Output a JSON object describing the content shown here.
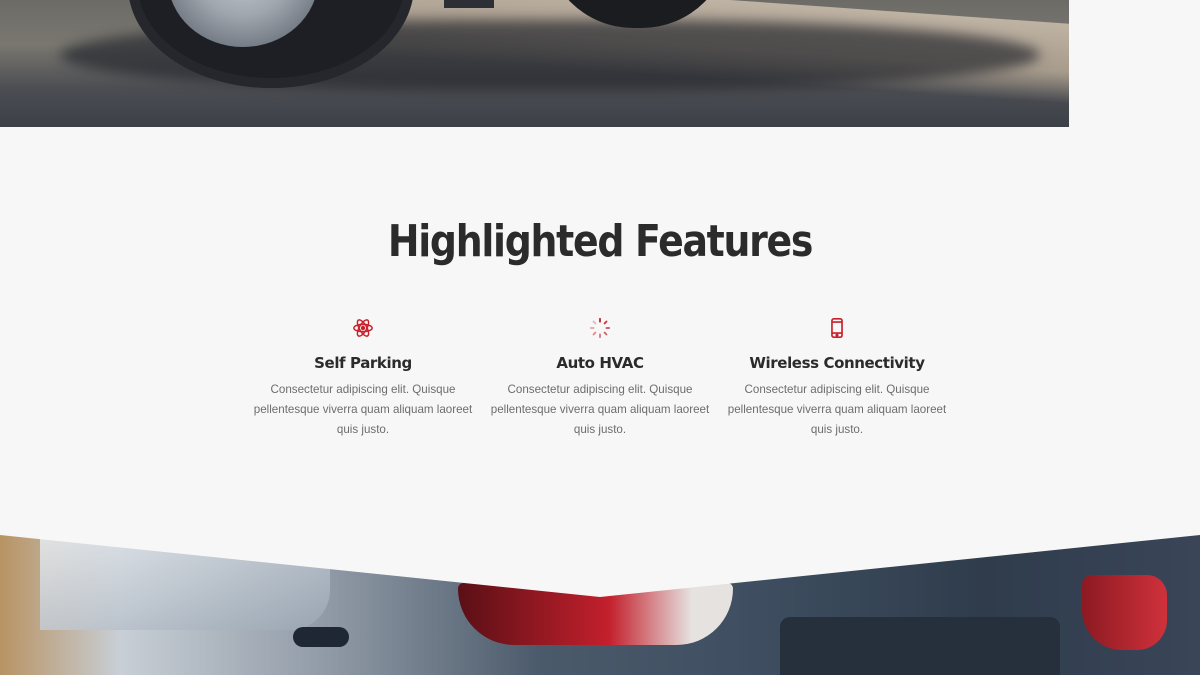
{
  "section": {
    "title": "Highlighted Features"
  },
  "accent_color": "#c8202b",
  "features": [
    {
      "icon": "atom-icon",
      "title": "Self Parking",
      "description": "Consectetur adipiscing elit. Quisque pellentesque viverra quam aliquam laoreet quis justo."
    },
    {
      "icon": "spinner-icon",
      "title": "Auto HVAC",
      "description": "Consectetur adipiscing elit. Quisque pellentesque viverra quam aliquam laoreet quis justo."
    },
    {
      "icon": "mobile-phone-icon",
      "title": "Wireless Connectivity",
      "description": "Consectetur adipiscing elit. Quisque pellentesque viverra quam aliquam laoreet quis justo."
    }
  ]
}
